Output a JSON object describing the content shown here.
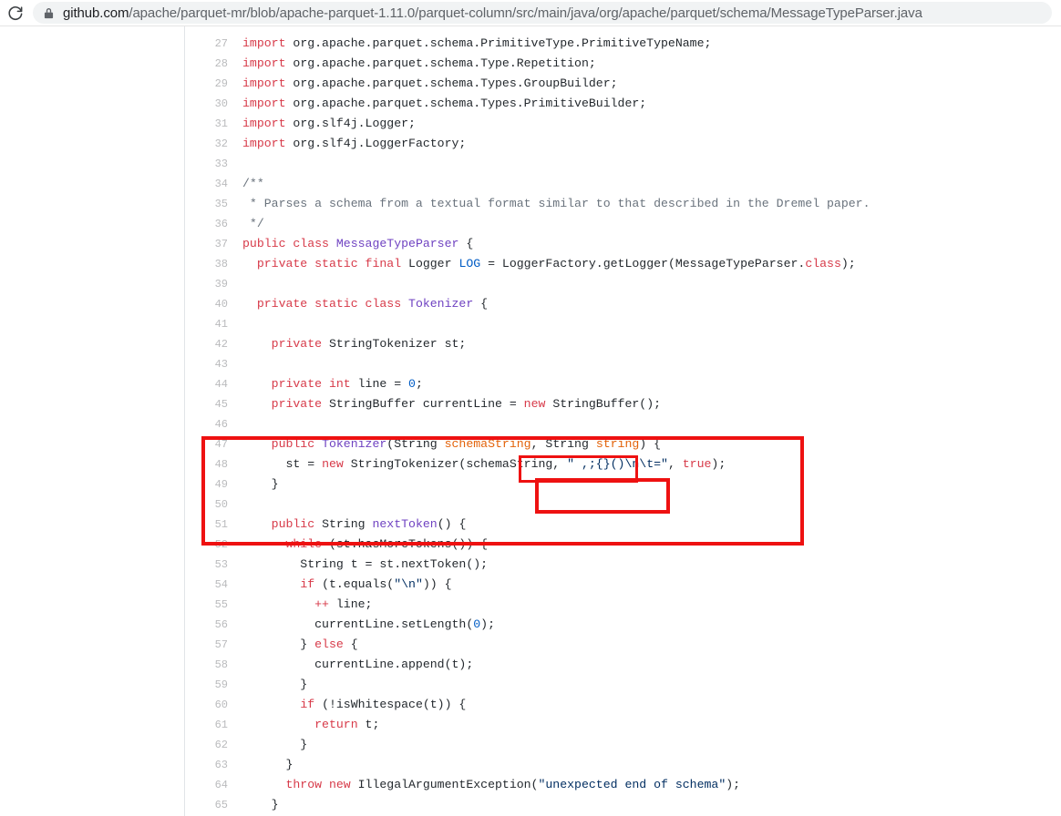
{
  "browser": {
    "reload_icon": "reload-icon",
    "lock_icon": "lock-icon",
    "url_host": "github.com",
    "url_path": "/apache/parquet-mr/blob/apache-parquet-1.11.0/parquet-column/src/main/java/org/apache/parquet/schema/MessageTypeParser.java",
    "url_full": "github.com/apache/parquet-mr/blob/apache-parquet-1.11.0/parquet-column/src/main/java/org/apache/parquet/schema/MessageTypeParser.java"
  },
  "theme": {
    "keyword": "#d73a49",
    "type": "#6f42c1",
    "string": "#032f62",
    "number": "#005cc5",
    "comment": "#6a737d",
    "parameter": "#e36209",
    "plain": "#24292e",
    "gutter": "#babbbd",
    "annotation": "#ee1111"
  },
  "code": {
    "language": "java",
    "first_line_number": 27,
    "lines": [
      {
        "n": "27",
        "tokens": [
          {
            "t": "import ",
            "c": "k"
          },
          {
            "t": "org.apache.parquet.schema.PrimitiveType.PrimitiveTypeName;",
            "c": "pl"
          }
        ]
      },
      {
        "n": "28",
        "tokens": [
          {
            "t": "import ",
            "c": "k"
          },
          {
            "t": "org.apache.parquet.schema.Type.Repetition;",
            "c": "pl"
          }
        ]
      },
      {
        "n": "29",
        "tokens": [
          {
            "t": "import ",
            "c": "k"
          },
          {
            "t": "org.apache.parquet.schema.Types.GroupBuilder;",
            "c": "pl"
          }
        ]
      },
      {
        "n": "30",
        "tokens": [
          {
            "t": "import ",
            "c": "k"
          },
          {
            "t": "org.apache.parquet.schema.Types.PrimitiveBuilder;",
            "c": "pl"
          }
        ]
      },
      {
        "n": "31",
        "tokens": [
          {
            "t": "import ",
            "c": "k"
          },
          {
            "t": "org.slf4j.Logger;",
            "c": "pl"
          }
        ]
      },
      {
        "n": "32",
        "tokens": [
          {
            "t": "import ",
            "c": "k"
          },
          {
            "t": "org.slf4j.LoggerFactory;",
            "c": "pl"
          }
        ]
      },
      {
        "n": "33",
        "tokens": []
      },
      {
        "n": "34",
        "tokens": [
          {
            "t": "/**",
            "c": "c"
          }
        ]
      },
      {
        "n": "35",
        "tokens": [
          {
            "t": " * Parses a schema from a textual format similar to that described in the Dremel paper.",
            "c": "c"
          }
        ]
      },
      {
        "n": "36",
        "tokens": [
          {
            "t": " */",
            "c": "c"
          }
        ]
      },
      {
        "n": "37",
        "tokens": [
          {
            "t": "public class ",
            "c": "k"
          },
          {
            "t": "MessageTypeParser",
            "c": "t"
          },
          {
            "t": " {",
            "c": "pl"
          }
        ]
      },
      {
        "n": "38",
        "tokens": [
          {
            "t": "  ",
            "c": "pl"
          },
          {
            "t": "private static final ",
            "c": "k"
          },
          {
            "t": "Logger ",
            "c": "pl"
          },
          {
            "t": "LOG",
            "c": "n"
          },
          {
            "t": " = LoggerFactory.getLogger(MessageTypeParser.",
            "c": "pl"
          },
          {
            "t": "class",
            "c": "k"
          },
          {
            "t": ");",
            "c": "pl"
          }
        ]
      },
      {
        "n": "39",
        "tokens": []
      },
      {
        "n": "40",
        "tokens": [
          {
            "t": "  ",
            "c": "pl"
          },
          {
            "t": "private static class ",
            "c": "k"
          },
          {
            "t": "Tokenizer",
            "c": "t"
          },
          {
            "t": " {",
            "c": "pl"
          }
        ]
      },
      {
        "n": "41",
        "tokens": []
      },
      {
        "n": "42",
        "tokens": [
          {
            "t": "    ",
            "c": "pl"
          },
          {
            "t": "private ",
            "c": "k"
          },
          {
            "t": "StringTokenizer st;",
            "c": "pl"
          }
        ]
      },
      {
        "n": "43",
        "tokens": []
      },
      {
        "n": "44",
        "tokens": [
          {
            "t": "    ",
            "c": "pl"
          },
          {
            "t": "private ",
            "c": "k"
          },
          {
            "t": "int ",
            "c": "k"
          },
          {
            "t": "line = ",
            "c": "pl"
          },
          {
            "t": "0",
            "c": "n"
          },
          {
            "t": ";",
            "c": "pl"
          }
        ]
      },
      {
        "n": "45",
        "tokens": [
          {
            "t": "    ",
            "c": "pl"
          },
          {
            "t": "private ",
            "c": "k"
          },
          {
            "t": "StringBuffer currentLine = ",
            "c": "pl"
          },
          {
            "t": "new ",
            "c": "k"
          },
          {
            "t": "StringBuffer();",
            "c": "pl"
          }
        ]
      },
      {
        "n": "46",
        "tokens": []
      },
      {
        "n": "47",
        "tokens": [
          {
            "t": "    ",
            "c": "pl"
          },
          {
            "t": "public ",
            "c": "k"
          },
          {
            "t": "Tokenizer",
            "c": "t"
          },
          {
            "t": "(String ",
            "c": "pl"
          },
          {
            "t": "schemaString",
            "c": "p"
          },
          {
            "t": ", String ",
            "c": "pl"
          },
          {
            "t": "string",
            "c": "p"
          },
          {
            "t": ") {",
            "c": "pl"
          }
        ]
      },
      {
        "n": "48",
        "tokens": [
          {
            "t": "      st = ",
            "c": "pl"
          },
          {
            "t": "new ",
            "c": "k"
          },
          {
            "t": "StringTokenizer(schemaString, ",
            "c": "pl"
          },
          {
            "t": "\" ,;{}()\\n\\t=\"",
            "c": "s"
          },
          {
            "t": ", ",
            "c": "pl"
          },
          {
            "t": "true",
            "c": "k"
          },
          {
            "t": ");",
            "c": "pl"
          }
        ]
      },
      {
        "n": "49",
        "tokens": [
          {
            "t": "    }",
            "c": "pl"
          }
        ]
      },
      {
        "n": "50",
        "tokens": []
      },
      {
        "n": "51",
        "tokens": [
          {
            "t": "    ",
            "c": "pl"
          },
          {
            "t": "public ",
            "c": "k"
          },
          {
            "t": "String ",
            "c": "pl"
          },
          {
            "t": "nextToken",
            "c": "t"
          },
          {
            "t": "() {",
            "c": "pl"
          }
        ]
      },
      {
        "n": "52",
        "tokens": [
          {
            "t": "      ",
            "c": "pl"
          },
          {
            "t": "while ",
            "c": "k"
          },
          {
            "t": "(st.hasMoreTokens()) {",
            "c": "pl"
          }
        ]
      },
      {
        "n": "53",
        "tokens": [
          {
            "t": "        String t = st.nextToken();",
            "c": "pl"
          }
        ]
      },
      {
        "n": "54",
        "tokens": [
          {
            "t": "        ",
            "c": "pl"
          },
          {
            "t": "if ",
            "c": "k"
          },
          {
            "t": "(t.equals(",
            "c": "pl"
          },
          {
            "t": "\"\\n\"",
            "c": "s"
          },
          {
            "t": ")) {",
            "c": "pl"
          }
        ]
      },
      {
        "n": "55",
        "tokens": [
          {
            "t": "          ",
            "c": "pl"
          },
          {
            "t": "++ ",
            "c": "k"
          },
          {
            "t": "line;",
            "c": "pl"
          }
        ]
      },
      {
        "n": "56",
        "tokens": [
          {
            "t": "          currentLine.setLength(",
            "c": "pl"
          },
          {
            "t": "0",
            "c": "n"
          },
          {
            "t": ");",
            "c": "pl"
          }
        ]
      },
      {
        "n": "57",
        "tokens": [
          {
            "t": "        } ",
            "c": "pl"
          },
          {
            "t": "else ",
            "c": "k"
          },
          {
            "t": "{",
            "c": "pl"
          }
        ]
      },
      {
        "n": "58",
        "tokens": [
          {
            "t": "          currentLine.append(t);",
            "c": "pl"
          }
        ]
      },
      {
        "n": "59",
        "tokens": [
          {
            "t": "        }",
            "c": "pl"
          }
        ]
      },
      {
        "n": "60",
        "tokens": [
          {
            "t": "        ",
            "c": "pl"
          },
          {
            "t": "if ",
            "c": "k"
          },
          {
            "t": "(!isWhitespace(t)) {",
            "c": "pl"
          }
        ]
      },
      {
        "n": "61",
        "tokens": [
          {
            "t": "          ",
            "c": "pl"
          },
          {
            "t": "return ",
            "c": "k"
          },
          {
            "t": "t;",
            "c": "pl"
          }
        ]
      },
      {
        "n": "62",
        "tokens": [
          {
            "t": "        }",
            "c": "pl"
          }
        ]
      },
      {
        "n": "63",
        "tokens": [
          {
            "t": "      }",
            "c": "pl"
          }
        ]
      },
      {
        "n": "64",
        "tokens": [
          {
            "t": "      ",
            "c": "pl"
          },
          {
            "t": "throw new ",
            "c": "k"
          },
          {
            "t": "IllegalArgumentException(",
            "c": "pl"
          },
          {
            "t": "\"unexpected end of schema\"",
            "c": "s"
          },
          {
            "t": ");",
            "c": "pl"
          }
        ]
      },
      {
        "n": "65",
        "tokens": [
          {
            "t": "    }",
            "c": "pl"
          }
        ]
      }
    ]
  },
  "annotations": [
    {
      "name": "highlight-constructor-block",
      "label": ""
    },
    {
      "name": "highlight-string-parameter",
      "label": ""
    },
    {
      "name": "highlight-delimiter-literal",
      "label": ""
    }
  ]
}
